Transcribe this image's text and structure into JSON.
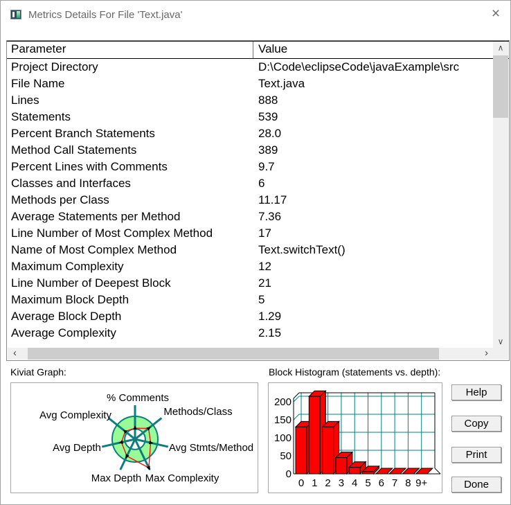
{
  "window": {
    "title": "Metrics Details For File 'Text.java'",
    "close_glyph": "×"
  },
  "icons": {
    "app_icon": "sourcemonitor-app-icon",
    "close": "close-icon",
    "scroll_up": "∧",
    "scroll_down": "∨",
    "scroll_left": "‹",
    "scroll_right": "›"
  },
  "table": {
    "columns": [
      "Parameter",
      "Value"
    ],
    "rows": [
      [
        "Project Directory",
        "D:\\Code\\eclipseCode\\javaExample\\src"
      ],
      [
        "File Name",
        "Text.java"
      ],
      [
        "Lines",
        "888"
      ],
      [
        "Statements",
        "539"
      ],
      [
        "Percent Branch Statements",
        "28.0"
      ],
      [
        "Method Call Statements",
        "389"
      ],
      [
        "Percent Lines with Comments",
        "9.7"
      ],
      [
        "Classes and Interfaces",
        "6"
      ],
      [
        "Methods per Class",
        "11.17"
      ],
      [
        "Average Statements per Method",
        "7.36"
      ],
      [
        "Line Number of Most Complex Method",
        "17"
      ],
      [
        "Name of Most Complex Method",
        "Text.switchText()"
      ],
      [
        "Maximum Complexity",
        "12"
      ],
      [
        "Line Number of Deepest Block",
        "21"
      ],
      [
        "Maximum Block Depth",
        "5"
      ],
      [
        "Average Block Depth",
        "1.29"
      ],
      [
        "Average Complexity",
        "2.15"
      ]
    ]
  },
  "buttons": [
    "Help",
    "Copy",
    "Print",
    "Done"
  ],
  "chart_data": [
    {
      "type": "radar",
      "title": "Kiviat Graph:",
      "axes": [
        "% Comments",
        "Methods/Class",
        "Avg Stmts/Method",
        "Max Complexity",
        "Max Depth",
        "Avg Depth",
        "Avg Complexity"
      ],
      "values": [
        9.7,
        11.17,
        7.36,
        12,
        5,
        1.29,
        2.15
      ],
      "radii_norm": [
        0.48,
        0.76,
        0.7,
        1.39,
        0.82,
        0.61,
        0.55
      ],
      "ring_inner_norm": 0.45,
      "colors": {
        "ring": "#98fb98",
        "axis": "#0e7d7d",
        "data": "#ff0000",
        "marker": "#000000"
      }
    },
    {
      "type": "bar",
      "title": "Block Histogram (statements vs. depth):",
      "xlabel": "depth",
      "ylabel": "statements",
      "categories": [
        "0",
        "1",
        "2",
        "3",
        "4",
        "5",
        "6",
        "7",
        "8",
        "9+"
      ],
      "values": [
        130,
        215,
        130,
        45,
        18,
        6,
        0,
        0,
        0,
        0
      ],
      "yticks": [
        0,
        50,
        100,
        150,
        200
      ],
      "ylim": [
        0,
        230
      ],
      "grid": true,
      "legend": false,
      "colors": {
        "bar": "#ff0000",
        "grid": "#008080",
        "frame": "#000000"
      }
    }
  ]
}
